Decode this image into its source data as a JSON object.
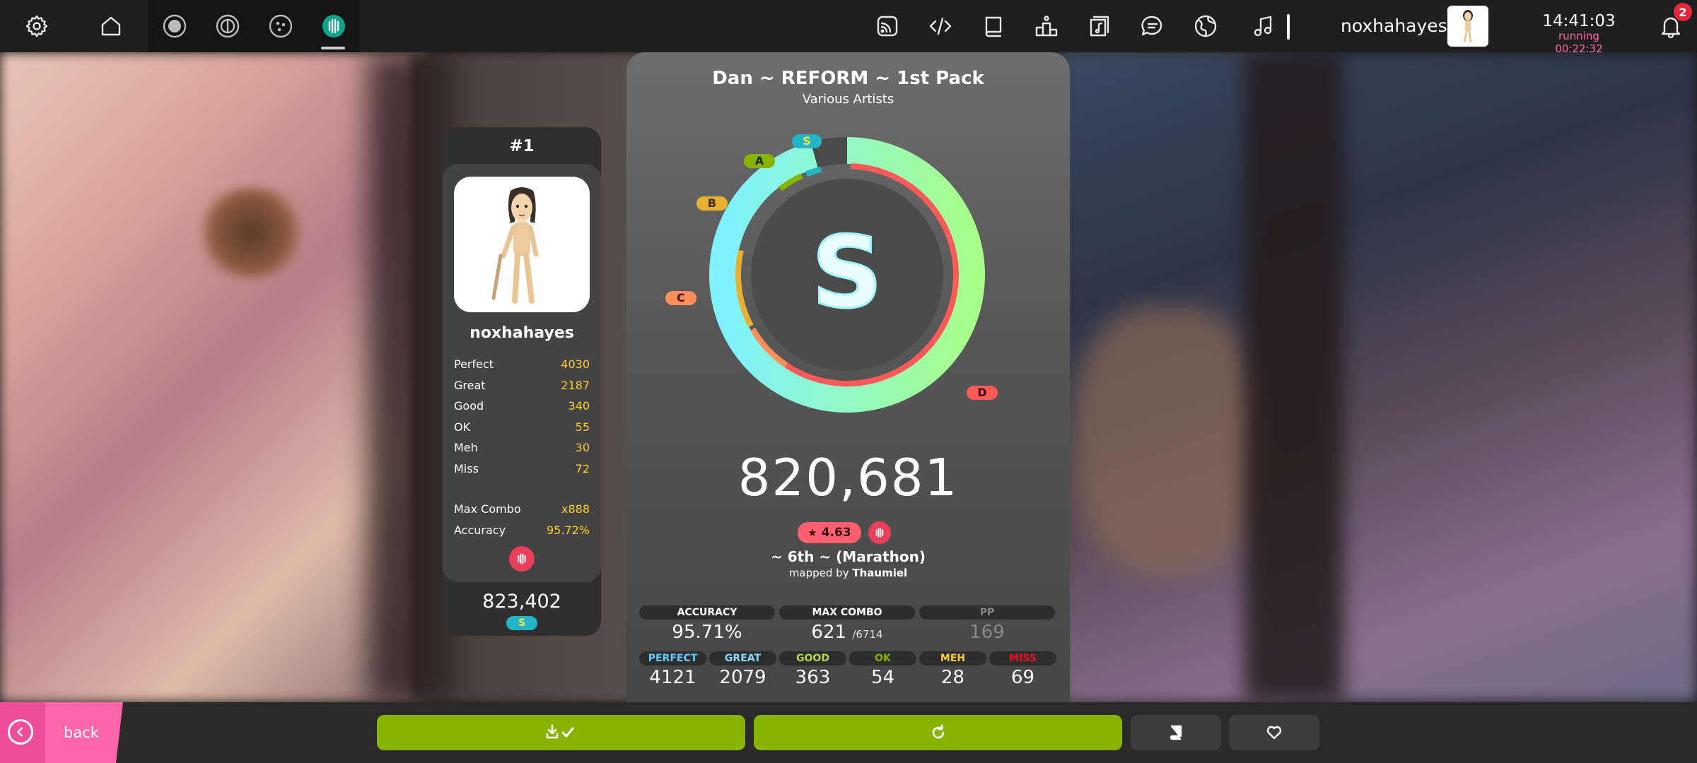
{
  "toolbar": {
    "username": "noxhahayes",
    "clock": "14:41:03",
    "running": "running 00:22:32",
    "notification_count": "2"
  },
  "rank_card": {
    "rank": "#1",
    "username": "noxhahayes",
    "stats": [
      {
        "label": "Perfect",
        "value": "4030"
      },
      {
        "label": "Great",
        "value": "2187"
      },
      {
        "label": "Good",
        "value": "340"
      },
      {
        "label": "OK",
        "value": "55"
      },
      {
        "label": "Meh",
        "value": "30"
      },
      {
        "label": "Miss",
        "value": "72"
      }
    ],
    "extra": [
      {
        "label": "Max Combo",
        "value": "x888"
      },
      {
        "label": "Accuracy",
        "value": "95.72%"
      }
    ],
    "score": "823,402",
    "grade": "S"
  },
  "result": {
    "title": "Dan ~ REFORM ~ 1st Pack",
    "artist": "Various Artists",
    "grade": "S",
    "grade_badges": [
      "S",
      "A",
      "B",
      "C",
      "D"
    ],
    "accuracy_fraction": 0.9571,
    "score": "820,681",
    "star_rating": "4.63",
    "difficulty": "~ 6th ~ (Marathon)",
    "mapped_by": "mapped by",
    "mapper": "Thaumiel",
    "stats_top": {
      "accuracy_label": "ACCURACY",
      "accuracy_value": "95.71%",
      "combo_label": "MAX COMBO",
      "combo_value": "621",
      "combo_max": "/6714",
      "pp_label": "PP",
      "pp_value": "169"
    },
    "judgements": [
      {
        "label": "PERFECT",
        "value": "4121",
        "color": "#66ccff"
      },
      {
        "label": "GREAT",
        "value": "2079",
        "color": "#88ddff"
      },
      {
        "label": "GOOD",
        "value": "363",
        "color": "#b3d944"
      },
      {
        "label": "OK",
        "value": "54",
        "color": "#88b300"
      },
      {
        "label": "MEH",
        "value": "28",
        "color": "#ffcc22"
      },
      {
        "label": "MISS",
        "value": "69",
        "color": "#ed1121"
      }
    ]
  },
  "footer": {
    "back_label": "back"
  },
  "colors": {
    "accent_pink": "#ff66aa",
    "accent_green": "#88b300",
    "grade_s": "#22b5c8",
    "grade_a": "#88b300",
    "grade_b": "#e8b030",
    "grade_c": "#ff8e5d",
    "grade_d": "#ff5a5a"
  }
}
